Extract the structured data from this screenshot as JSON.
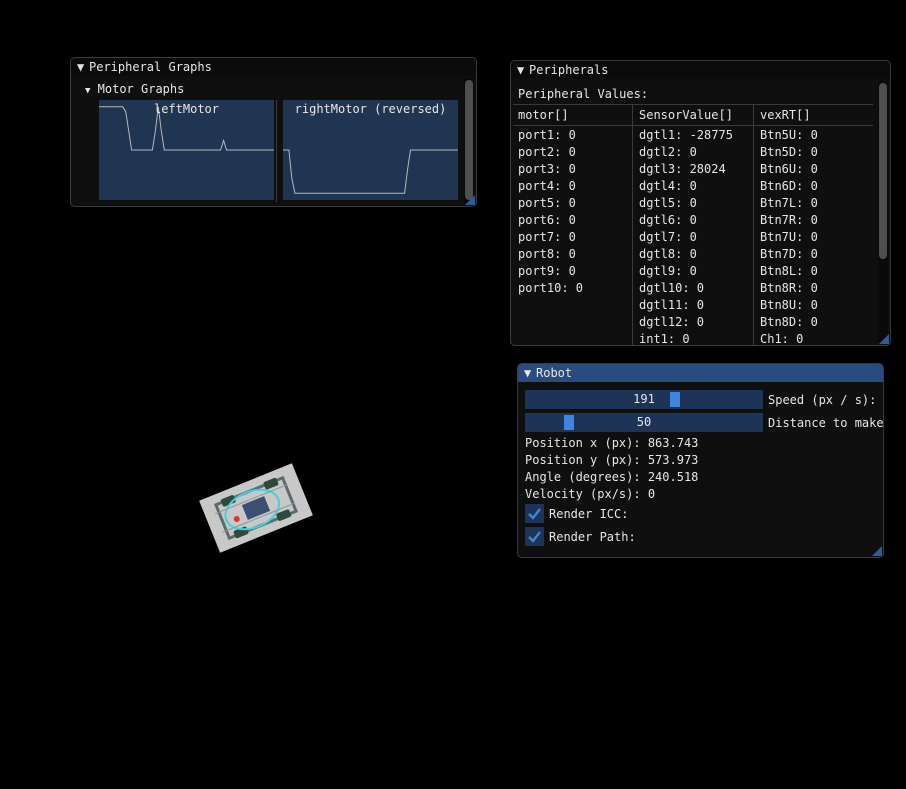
{
  "graphs_window": {
    "title": "Peripheral Graphs",
    "section": "Motor Graphs",
    "plots": [
      {
        "title": "leftMotor",
        "values": [
          0.95,
          0.95,
          0.95,
          0.95,
          0.95,
          0.95,
          0.95,
          0.95,
          0.95,
          0.9,
          0.7,
          0.5,
          0.5,
          0.5,
          0.5,
          0.5,
          0.5,
          0.5,
          0.5,
          0.7,
          0.95,
          0.7,
          0.5,
          0.5,
          0.5,
          0.5,
          0.5,
          0.5,
          0.5,
          0.5,
          0.5,
          0.5,
          0.5,
          0.5,
          0.5,
          0.5,
          0.5,
          0.5,
          0.5,
          0.5,
          0.5,
          0.5,
          0.6,
          0.5,
          0.5,
          0.5,
          0.5,
          0.5,
          0.5,
          0.5,
          0.5,
          0.5,
          0.5,
          0.5,
          0.5,
          0.5,
          0.5,
          0.5,
          0.5,
          0.5
        ]
      },
      {
        "title": "rightMotor (reversed)",
        "values": [
          0.5,
          0.5,
          0.5,
          0.2,
          0.05,
          0.05,
          0.05,
          0.05,
          0.05,
          0.05,
          0.05,
          0.05,
          0.05,
          0.05,
          0.05,
          0.05,
          0.05,
          0.05,
          0.05,
          0.05,
          0.05,
          0.05,
          0.05,
          0.05,
          0.05,
          0.05,
          0.05,
          0.05,
          0.05,
          0.05,
          0.05,
          0.05,
          0.05,
          0.05,
          0.05,
          0.05,
          0.05,
          0.05,
          0.05,
          0.05,
          0.05,
          0.05,
          0.3,
          0.5,
          0.5,
          0.5,
          0.5,
          0.5,
          0.5,
          0.5,
          0.5,
          0.5,
          0.5,
          0.5,
          0.5,
          0.5,
          0.5,
          0.5,
          0.5,
          0.5
        ]
      }
    ]
  },
  "peripherals_window": {
    "title": "Peripherals",
    "heading": "Peripheral Values:",
    "columns": [
      "motor[]",
      "SensorValue[]",
      "vexRT[]"
    ],
    "motor": [
      "port1: 0",
      "port2: 0",
      "port3: 0",
      "port4: 0",
      "port5: 0",
      "port6: 0",
      "port7: 0",
      "port8: 0",
      "port9: 0",
      "port10: 0"
    ],
    "sensor": [
      "dgtl1: -28775",
      "dgtl2: 0",
      "dgtl3: 28024",
      "dgtl4: 0",
      "dgtl5: 0",
      "dgtl6: 0",
      "dgtl7: 0",
      "dgtl8: 0",
      "dgtl9: 0",
      "dgtl10: 0",
      "dgtl11: 0",
      "dgtl12: 0",
      "int1: 0"
    ],
    "vexrt": [
      "Btn5U: 0",
      "Btn5D: 0",
      "Btn6U: 0",
      "Btn6D: 0",
      "Btn7L: 0",
      "Btn7R: 0",
      "Btn7U: 0",
      "Btn7D: 0",
      "Btn8L: 0",
      "Btn8R: 0",
      "Btn8U: 0",
      "Btn8D: 0",
      "Ch1: 0"
    ]
  },
  "robot_window": {
    "title": "Robot",
    "speed": {
      "value": "191",
      "label": "Speed (px / s):"
    },
    "distance": {
      "value": "50",
      "label": "Distance to make"
    },
    "pos_x": "Position x (px): 863.743",
    "pos_y": "Position y (px): 573.973",
    "angle": "Angle (degrees): 240.518",
    "velocity": "Velocity (px/s): 0",
    "render_icc": "Render ICC:",
    "render_path": "Render Path:"
  },
  "colors": {
    "accent": "#3d85e0",
    "title_active": "#2a4b7d",
    "frame_bg": "#1d3456",
    "plot_bg": "#1f3552"
  }
}
